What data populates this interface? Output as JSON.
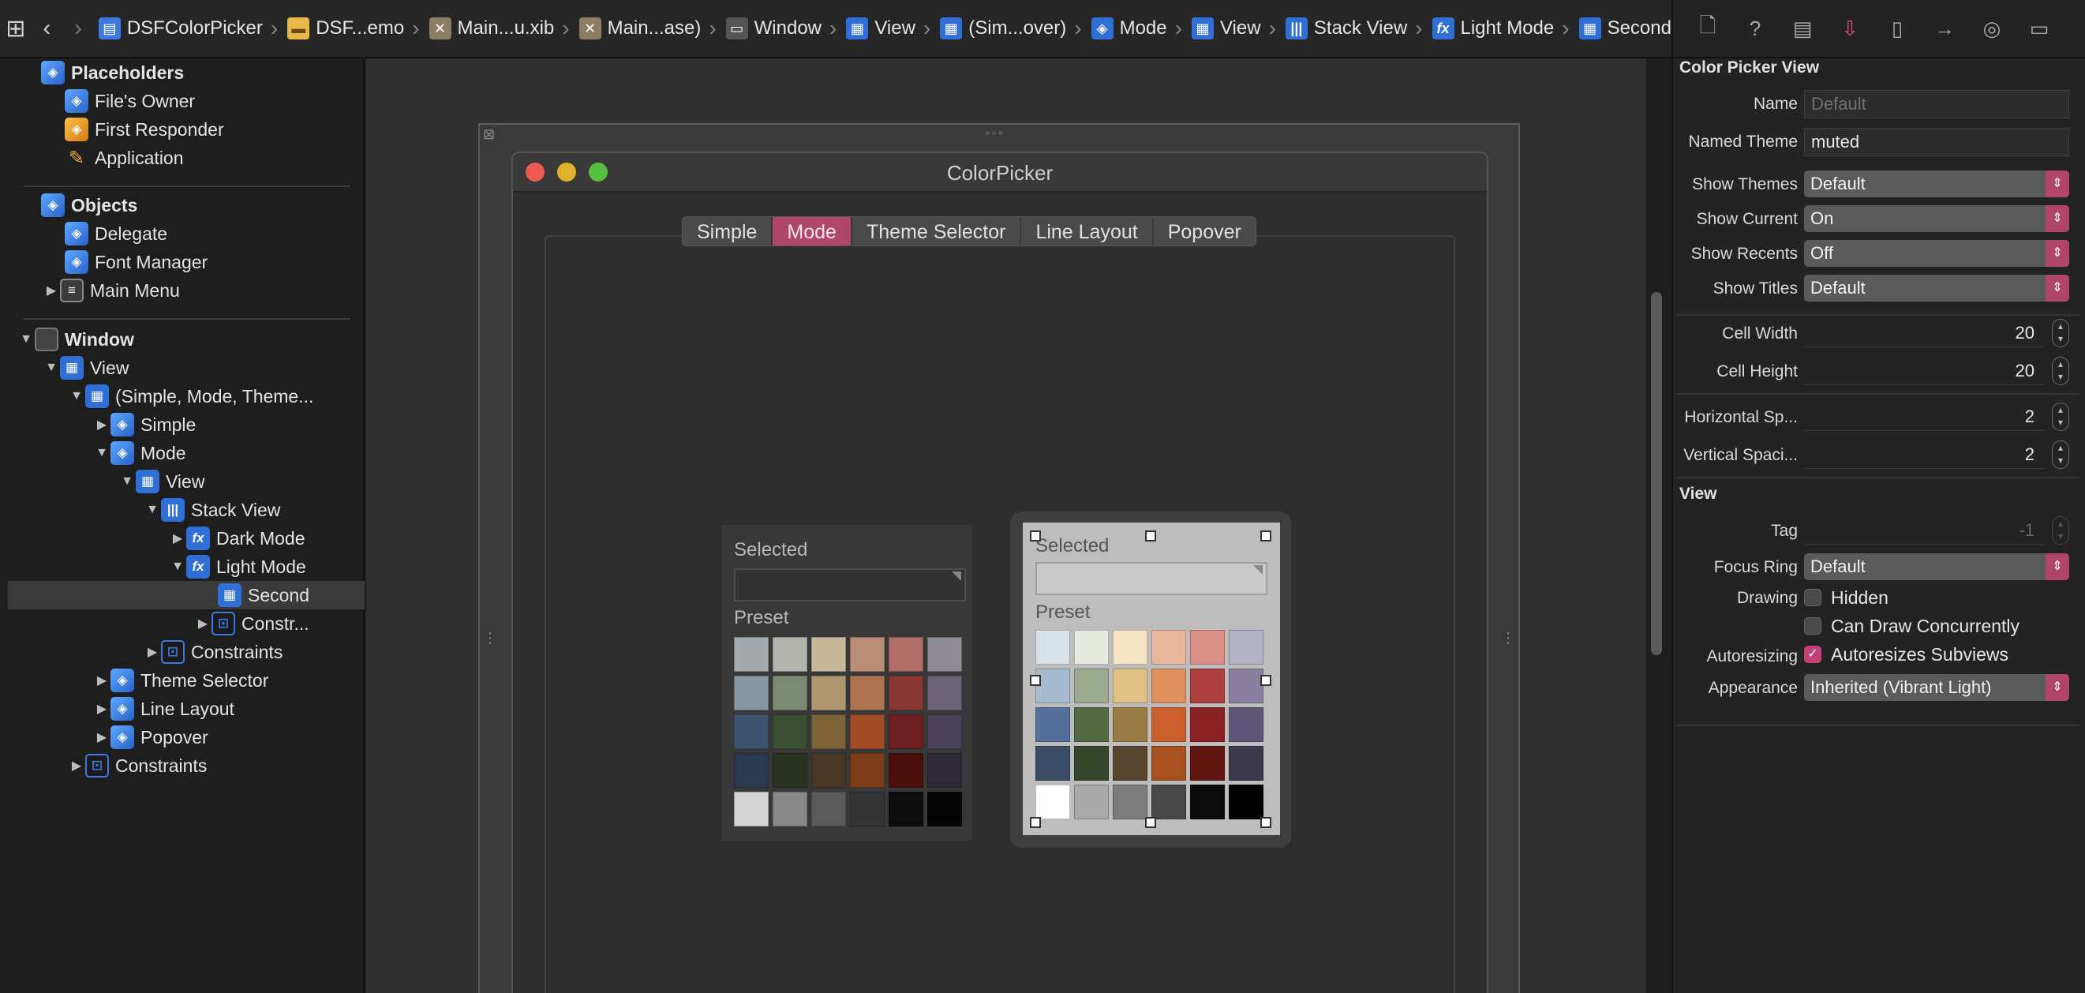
{
  "jumpbar": {
    "crumbs": [
      {
        "label": "DSFColorPicker",
        "icon": "project-file-icon"
      },
      {
        "label": "DSF...emo",
        "icon": "folder-icon"
      },
      {
        "label": "Main...u.xib",
        "icon": "xib-file-icon"
      },
      {
        "label": "Main...ase)",
        "icon": "xib-file-icon"
      },
      {
        "label": "Window",
        "icon": "window-icon"
      },
      {
        "label": "View",
        "icon": "view-icon"
      },
      {
        "label": "(Sim...over)",
        "icon": "view-icon"
      },
      {
        "label": "Mode",
        "icon": "cube-icon"
      },
      {
        "label": "View",
        "icon": "view-icon"
      },
      {
        "label": "Stack View",
        "icon": "stack-view-icon"
      },
      {
        "label": "Light Mode",
        "icon": "fx-icon"
      },
      {
        "label": "Second",
        "icon": "view-icon"
      }
    ]
  },
  "outline": {
    "placeholders": "Placeholders",
    "files_owner": "File's Owner",
    "first_responder": "First Responder",
    "application": "Application",
    "objects": "Objects",
    "delegate": "Delegate",
    "font_manager": "Font Manager",
    "main_menu": "Main Menu",
    "window": "Window",
    "view": "View",
    "tabview": "(Simple, Mode, Theme...",
    "simple": "Simple",
    "mode": "Mode",
    "mode_view": "View",
    "stack_view": "Stack View",
    "dark_mode": "Dark Mode",
    "light_mode": "Light Mode",
    "second": "Second",
    "constr_short": "Constr...",
    "constraints_inner": "Constraints",
    "theme_selector": "Theme Selector",
    "line_layout": "Line Layout",
    "popover": "Popover",
    "constraints_outer": "Constraints"
  },
  "canvas": {
    "window_title": "ColorPicker",
    "tabs": [
      "Simple",
      "Mode",
      "Theme Selector",
      "Line Layout",
      "Popover"
    ],
    "active_tab": "Mode",
    "picker_selected_label": "Selected",
    "picker_preset_label": "Preset",
    "dark_swatches": [
      "#a4a9ae",
      "#b2b4ad",
      "#c7b89a",
      "#bb8f77",
      "#b06e68",
      "#8e8b95",
      "#8796a3",
      "#7c8a74",
      "#af9870",
      "#ae7450",
      "#883834",
      "#6b6479",
      "#3d5470",
      "#3c4f32",
      "#7c6234",
      "#a24c25",
      "#6c1e20",
      "#49405a",
      "#2c3a50",
      "#2a3320",
      "#4a3826",
      "#7e3c17",
      "#4a100e",
      "#2e2a38",
      "#d4d4d4",
      "#898989",
      "#5b5b5b",
      "#343434",
      "#0d0d0d",
      "#050505"
    ],
    "light_swatches": [
      "#d9e1e8",
      "#e6eadf",
      "#f6e6c4",
      "#e8b59d",
      "#db9089",
      "#b4b2c7",
      "#a7bacd",
      "#9caa8f",
      "#dfc183",
      "#de8f5c",
      "#ad3f3e",
      "#8a7f9f",
      "#546f99",
      "#546a43",
      "#9a7b46",
      "#cc5f2e",
      "#8b2326",
      "#5e5577",
      "#3a4b65",
      "#34452a",
      "#584530",
      "#a7511f",
      "#5f160f",
      "#3b384c",
      "#ffffff",
      "#a9a9a9",
      "#7c7c7c",
      "#474747",
      "#0b0b0b",
      "#000000"
    ]
  },
  "inspector": {
    "tab_icons": [
      "file-icon",
      "help-icon",
      "identity-icon",
      "attributes-icon",
      "size-icon",
      "connections-icon",
      "bindings-icon",
      "effects-icon"
    ],
    "section_color_picker": "Color Picker View",
    "name_label": "Name",
    "name_placeholder": "Default",
    "named_theme_label": "Named Theme",
    "named_theme_value": "muted",
    "show_themes_label": "Show Themes",
    "show_themes_value": "Default",
    "show_current_label": "Show Current",
    "show_current_value": "On",
    "show_recents_label": "Show Recents",
    "show_recents_value": "Off",
    "show_titles_label": "Show Titles",
    "show_titles_value": "Default",
    "cell_width_label": "Cell Width",
    "cell_width_value": "20",
    "cell_height_label": "Cell Height",
    "cell_height_value": "20",
    "horizontal_spacing_label": "Horizontal Sp...",
    "horizontal_spacing_value": "2",
    "vertical_spacing_label": "Vertical Spaci...",
    "vertical_spacing_value": "2",
    "section_view": "View",
    "tag_label": "Tag",
    "tag_value": "-1",
    "focus_ring_label": "Focus Ring",
    "focus_ring_value": "Default",
    "drawing_label": "Drawing",
    "hidden_label": "Hidden",
    "hidden_checked": false,
    "concurrent_label": "Can Draw Concurrently",
    "concurrent_checked": false,
    "autoresizing_label": "Autoresizing",
    "autoresizes_label": "Autoresizes Subviews",
    "autoresizes_checked": true,
    "appearance_label": "Appearance",
    "appearance_value": "Inherited (Vibrant Light)"
  }
}
